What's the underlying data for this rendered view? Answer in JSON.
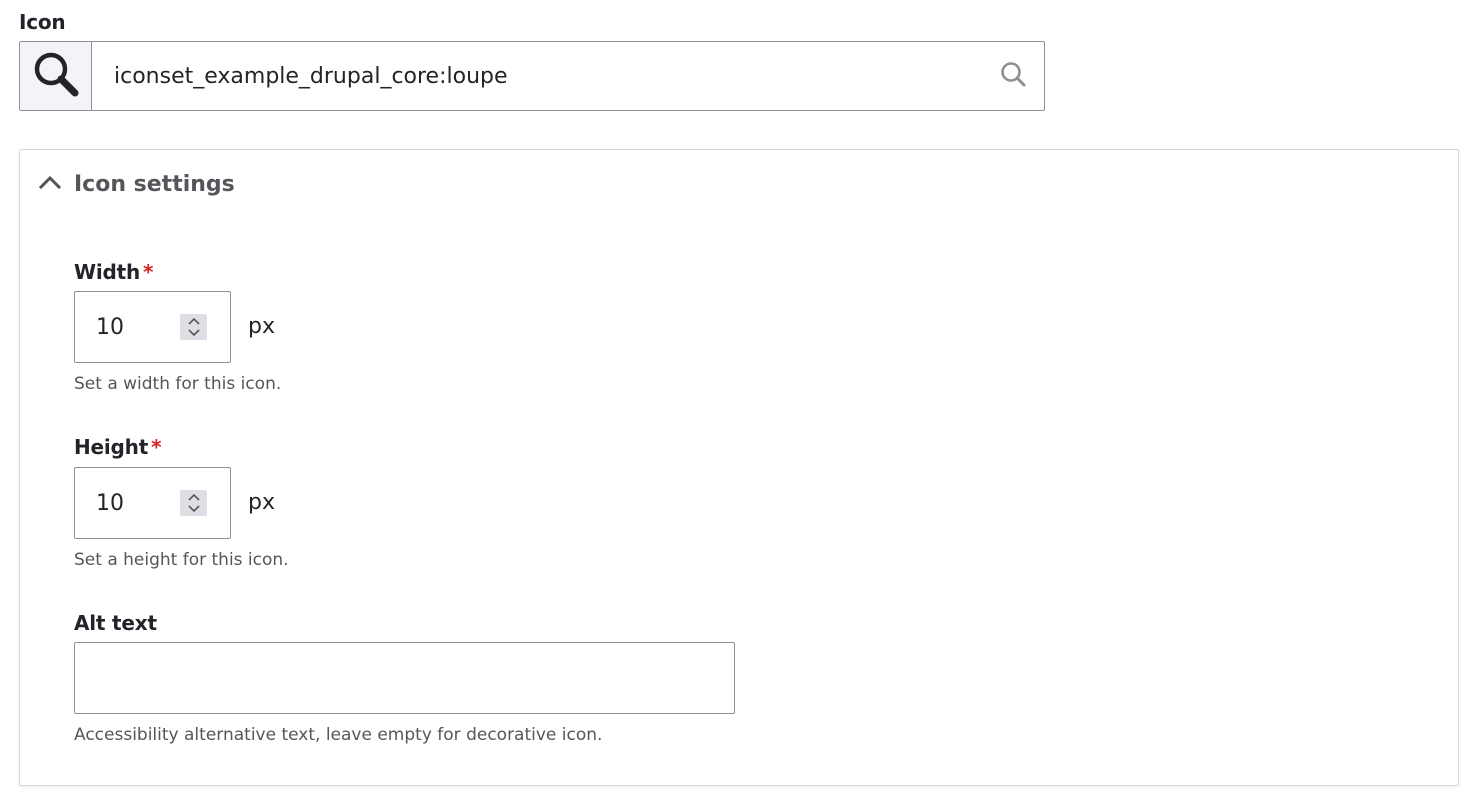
{
  "icon_field": {
    "label": "Icon",
    "value": "iconset_example_drupal_core:loupe",
    "preview_icon": "magnifier-icon",
    "search_icon": "search-icon"
  },
  "settings": {
    "title": "Icon settings",
    "expanded": true,
    "toggle_icon": "chevron-up-icon",
    "width": {
      "label": "Width",
      "required_mark": "*",
      "value": "10",
      "unit": "px",
      "description": "Set a width for this icon."
    },
    "height": {
      "label": "Height",
      "required_mark": "*",
      "value": "10",
      "unit": "px",
      "description": "Set a height for this icon."
    },
    "alt_text": {
      "label": "Alt text",
      "value": "",
      "description": "Accessibility alternative text, leave empty for decorative icon."
    }
  },
  "colors": {
    "required": "#d72222",
    "border": "#919297",
    "preview_bg": "#f3f4f9",
    "text": "#232429",
    "muted": "#55565b"
  }
}
